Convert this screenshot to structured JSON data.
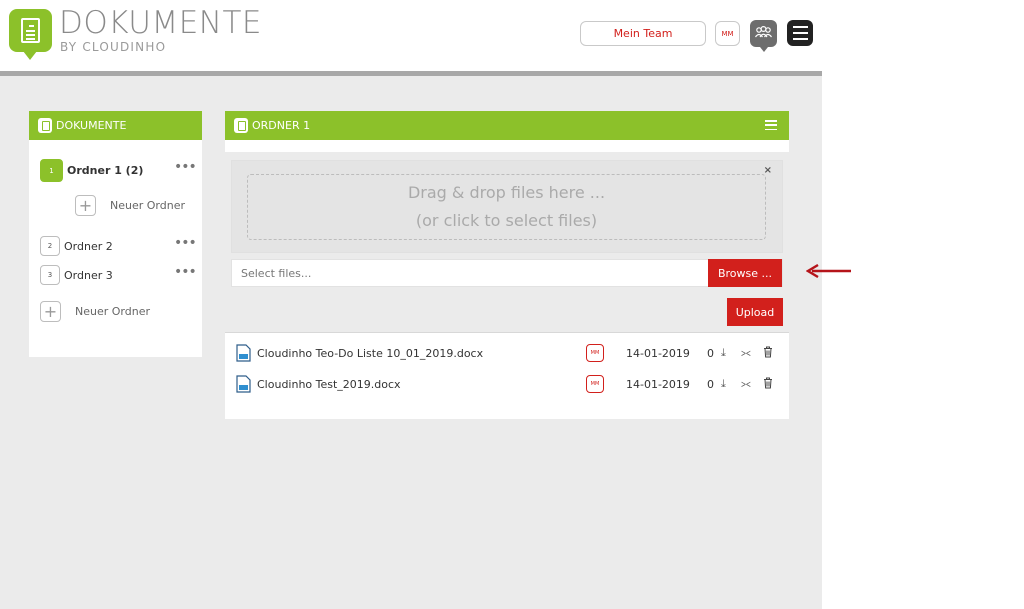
{
  "header": {
    "logo_title": "DOKUMENTE",
    "logo_subtitle": "BY CLOUDINHO",
    "team_button": "Mein Team",
    "user_initials": "MM"
  },
  "sidebar": {
    "title": "DOKUMENTE",
    "folders": [
      {
        "num": "1",
        "label": "Ordner 1 (2)",
        "active": true
      },
      {
        "num": "2",
        "label": "Ordner 2",
        "active": false
      },
      {
        "num": "3",
        "label": "Ordner 3",
        "active": false
      }
    ],
    "new_subfolder_label": "Neuer Ordner",
    "new_folder_label": "Neuer Ordner",
    "more_symbol": "•••"
  },
  "main": {
    "title": "ORDNER 1",
    "dropzone_line1": "Drag & drop files here ...",
    "dropzone_line2": "(or click to select files)",
    "close_symbol": "×",
    "select_placeholder": "Select files...",
    "browse_label": "Browse ...",
    "upload_label": "Upload",
    "files": [
      {
        "name": "Cloudinho Teo-Do Liste 10_01_2019.docx",
        "owner": "MM",
        "date": "14-01-2019",
        "count": "0"
      },
      {
        "name": "Cloudinho Test_2019.docx",
        "owner": "MM",
        "date": "14-01-2019",
        "count": "0"
      }
    ]
  },
  "colors": {
    "accent_green": "#8cc12a",
    "accent_red": "#d2201c",
    "background": "#ebebeb"
  },
  "icons": [
    "document-icon",
    "team-icon",
    "hamburger-menu-icon",
    "download-icon",
    "share-icon",
    "trash-icon",
    "docx-file-icon",
    "arrow-left-icon"
  ]
}
